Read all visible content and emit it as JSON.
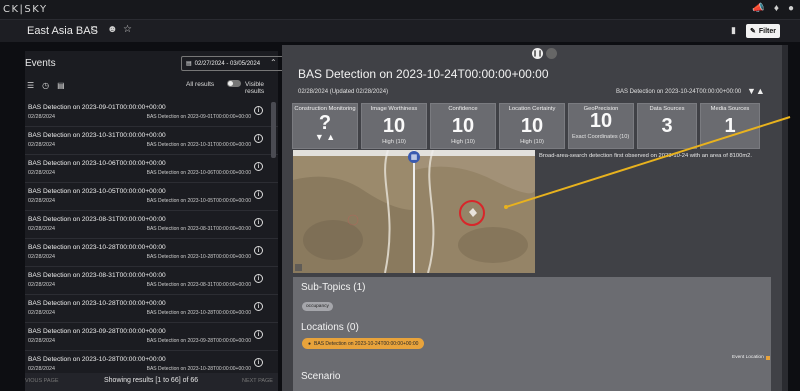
{
  "app": {
    "brand": "CK|SKY"
  },
  "header": {
    "project_title": "East Asia BAS",
    "filter_label": "Filter"
  },
  "events_panel": {
    "title": "Events",
    "date_range": "02/27/2024 - 03/05/2024",
    "all_results": "All results",
    "visible_results": "Visible results",
    "items": [
      {
        "title": "BAS Detection on 2023-09-01T00:00:00+00:00",
        "date": "02/28/2024",
        "sub": "BAS Detection on 2023-09-01T00:00:00+00:00"
      },
      {
        "title": "BAS Detection on 2023-10-31T00:00:00+00:00",
        "date": "02/28/2024",
        "sub": "BAS Detection on 2023-10-31T00:00:00+00:00"
      },
      {
        "title": "BAS Detection on 2023-10-06T00:00:00+00:00",
        "date": "02/28/2024",
        "sub": "BAS Detection on 2023-10-06T00:00:00+00:00"
      },
      {
        "title": "BAS Detection on 2023-10-05T00:00:00+00:00",
        "date": "02/28/2024",
        "sub": "BAS Detection on 2023-10-05T00:00:00+00:00"
      },
      {
        "title": "BAS Detection on 2023-08-31T00:00:00+00:00",
        "date": "02/28/2024",
        "sub": "BAS Detection on 2023-08-31T00:00:00+00:00"
      },
      {
        "title": "BAS Detection on 2023-10-28T00:00:00+00:00",
        "date": "02/28/2024",
        "sub": "BAS Detection on 2023-10-28T00:00:00+00:00"
      },
      {
        "title": "BAS Detection on 2023-08-31T00:00:00+00:00",
        "date": "02/28/2024",
        "sub": "BAS Detection on 2023-08-31T00:00:00+00:00"
      },
      {
        "title": "BAS Detection on 2023-10-28T00:00:00+00:00",
        "date": "02/28/2024",
        "sub": "BAS Detection on 2023-10-28T00:00:00+00:00"
      },
      {
        "title": "BAS Detection on 2023-09-28T00:00:00+00:00",
        "date": "02/28/2024",
        "sub": "BAS Detection on 2023-09-28T00:00:00+00:00"
      },
      {
        "title": "BAS Detection on 2023-10-28T00:00:00+00:00",
        "date": "02/28/2024",
        "sub": "BAS Detection on 2023-10-28T00:00:00+00:00"
      }
    ],
    "prev_page": "VIOUS PAGE",
    "showing": "Showing results [1 to 66] of 66",
    "next_page": "NEXT PAGE"
  },
  "detail": {
    "title": "BAS Detection on 2023-10-24T00:00:00+00:00",
    "date_line": "02/28/2024  (Updated 02/28/2024)",
    "right_line": "BAS Detection on 2023-10-24T00:00:00+00:00",
    "metrics": [
      {
        "label": "Construction Monitoring",
        "value": "?",
        "sub": ""
      },
      {
        "label": "Image Worthiness",
        "value": "10",
        "sub": "High (10)"
      },
      {
        "label": "Confidence",
        "value": "10",
        "sub": "High (10)"
      },
      {
        "label": "Location Certainty",
        "value": "10",
        "sub": "High (10)"
      },
      {
        "label": "GeoPrecision",
        "value": "10",
        "sub": "Exact Coordinates (10)"
      },
      {
        "label": "Data Sources",
        "value": "3",
        "sub": ""
      },
      {
        "label": "Media Sources",
        "value": "1",
        "sub": ""
      }
    ],
    "image_caption": "Broad-area-search detection first observed on 2023-10-24 with an area of 8100m2.",
    "subtopics_title": "Sub-Topics (1)",
    "subtopic_chip": "occupancy",
    "locations_title": "Locations (0)",
    "location_chip": "BAS Detection on 2023-10-24T00:00:00+00:00",
    "event_location": "Event Location",
    "scenario_title": "Scenario"
  },
  "colors": {
    "accent_orange": "#e8a33b",
    "callout_yellow": "#e8b21e",
    "marker_red": "#d8262a"
  }
}
